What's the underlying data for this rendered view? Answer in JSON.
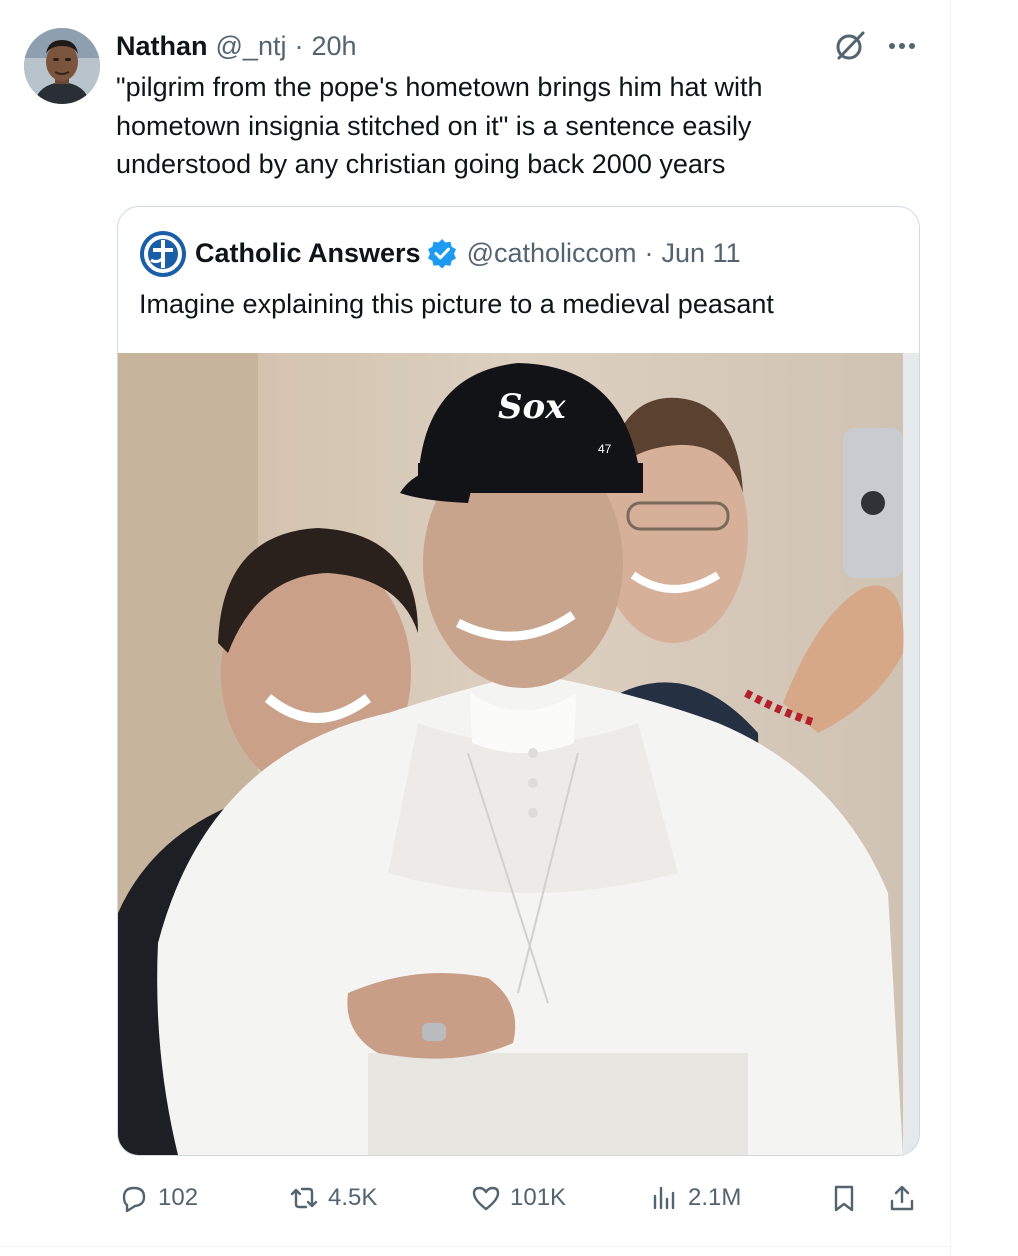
{
  "tweet": {
    "author_name": "Nathan",
    "handle": "@_ntj",
    "separator": "·",
    "time": "20h",
    "text_lines": [
      "\"pilgrim from the pope's hometown brings him hat with",
      "hometown insignia stitched on it\" is a sentence easily",
      "understood by any christian going back 2000 years"
    ],
    "icons": {
      "grok": "grok-icon",
      "more": "more-icon"
    }
  },
  "quote": {
    "author_name": "Catholic Answers",
    "handle": "@catholiccom",
    "separator": "·",
    "date": "Jun 11",
    "text": "Imagine explaining this picture to a medieval peasant",
    "cap_logo": "Sox",
    "cap_tag": "47",
    "verified_color": "#1d9bf0",
    "logo_color": "#1b5ea8"
  },
  "actions": {
    "replies": "102",
    "reposts": "4.5K",
    "likes": "101K",
    "views": "2.1M"
  },
  "colors": {
    "text": "#0f1419",
    "muted": "#536471",
    "border": "#cfd9de"
  }
}
